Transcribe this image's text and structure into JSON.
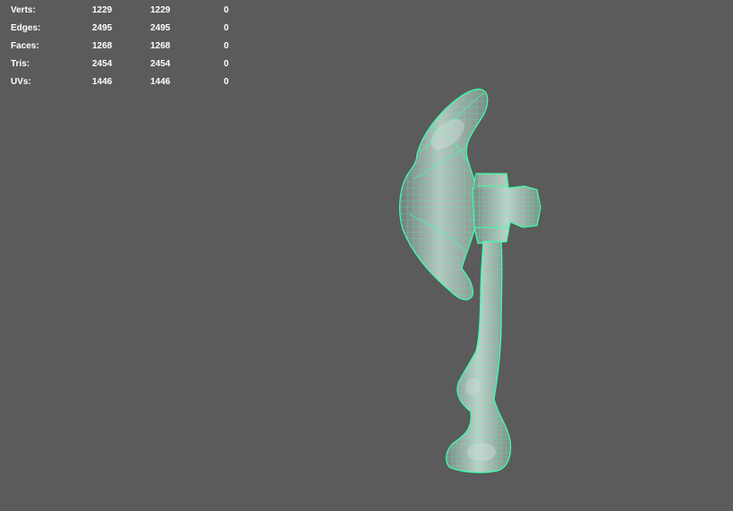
{
  "hud": {
    "rows": [
      {
        "label": "Verts:",
        "values": [
          "1229",
          "1229",
          "0"
        ]
      },
      {
        "label": "Edges:",
        "values": [
          "2495",
          "2495",
          "0"
        ]
      },
      {
        "label": "Faces:",
        "values": [
          "1268",
          "1268",
          "0"
        ]
      },
      {
        "label": "Tris:",
        "values": [
          "2454",
          "2454",
          "0"
        ]
      },
      {
        "label": "UVs:",
        "values": [
          "1446",
          "1446",
          "0"
        ]
      }
    ]
  },
  "colors": {
    "viewport_bg": "#5b5b5b",
    "wireframe": "#3dffa8",
    "shaded_surface": "#9aaaa6",
    "hud_text": "#ffffff"
  },
  "viewport": {
    "object_icon": "axe-mesh-wireframe"
  }
}
